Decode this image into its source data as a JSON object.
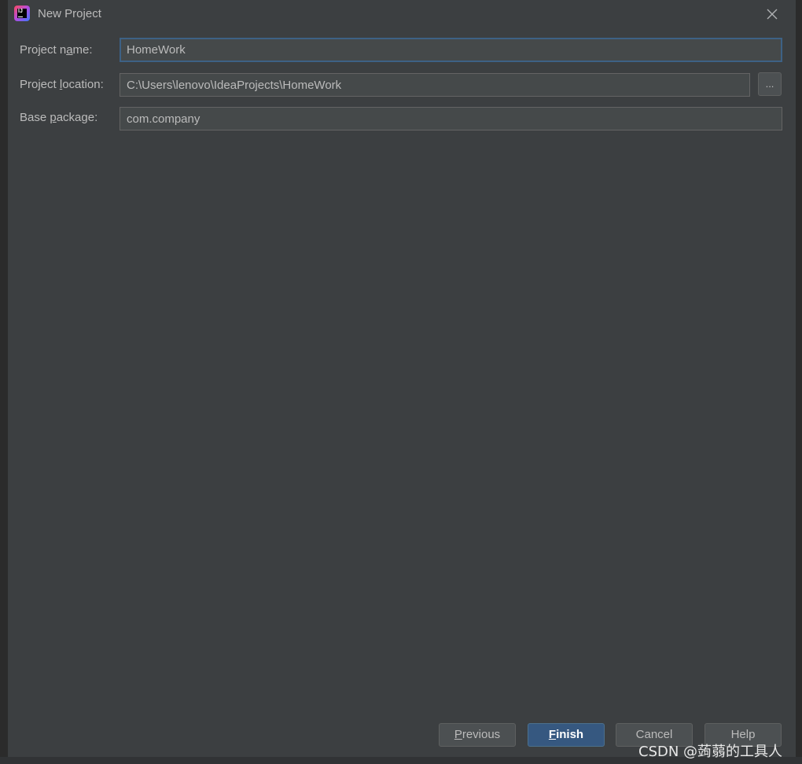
{
  "window": {
    "title": "New Project",
    "app_icon": "intellij-idea-icon",
    "close_icon": "close-icon"
  },
  "form": {
    "project_name": {
      "label_pre": "Project n",
      "label_mnemonic": "a",
      "label_post": "me:",
      "value": "HomeWork"
    },
    "project_location": {
      "label_pre": "Project ",
      "label_mnemonic": "l",
      "label_post": "ocation:",
      "value": "C:\\Users\\lenovo\\IdeaProjects\\HomeWork",
      "browse_label": "..."
    },
    "base_package": {
      "label_pre": "Base ",
      "label_mnemonic": "p",
      "label_post": "ackage:",
      "value": "com.company"
    }
  },
  "footer": {
    "previous": {
      "mnemonic": "P",
      "rest": "revious"
    },
    "finish": {
      "mnemonic": "F",
      "rest": "inish"
    },
    "cancel": "Cancel",
    "help": "Help"
  },
  "watermark": "CSDN @蒟蒻的工具人",
  "colors": {
    "background": "#3c3f41",
    "field_background": "#45494a",
    "focus_border": "#3d6185",
    "primary_button": "#365880",
    "text": "#bbbbbb"
  }
}
